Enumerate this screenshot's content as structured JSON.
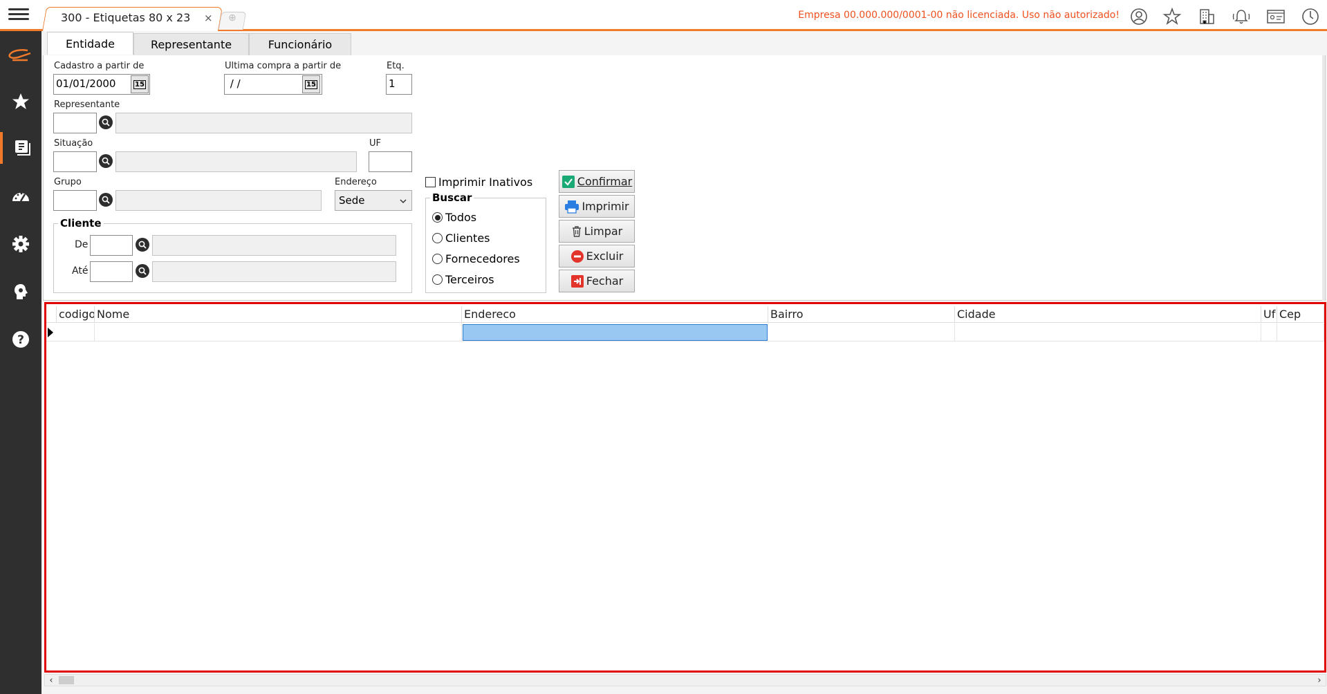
{
  "app": {
    "tab_title": "300 - Etiquetas 80 x 23",
    "tab_close": "×",
    "warning": "Empresa 00.000.000/0001-00 não licenciada. Uso não autorizado!"
  },
  "form_tabs": [
    "Entidade",
    "Representante",
    "Funcionário"
  ],
  "form": {
    "cadastro_label": "Cadastro a partir de",
    "cadastro_value": "01/01/2000",
    "ultima_compra_label": "Ultima compra a partir de",
    "ultima_compra_value": " / /",
    "etq_label": "Etq.",
    "etq_value": "1",
    "representante_label": "Representante",
    "situacao_label": "Situação",
    "uf_label": "UF",
    "grupo_label": "Grupo",
    "endereco_label": "Endereço",
    "endereco_value": "Sede",
    "cliente_group": "Cliente",
    "de_label": "De",
    "ate_label": "Até",
    "imprimir_inativos": "Imprimir Inativos",
    "buscar_group": "Buscar",
    "buscar_options": [
      "Todos",
      "Clientes",
      "Fornecedores",
      "Terceiros"
    ],
    "buscar_selected": "Todos",
    "cal_icon_text": "15"
  },
  "buttons": {
    "confirmar": "Confirmar",
    "imprimir": "Imprimir",
    "limpar": "Limpar",
    "excluir": "Excluir",
    "fechar": "Fechar"
  },
  "grid": {
    "columns": [
      "codigo",
      "Nome",
      "Endereco",
      "Bairro",
      "Cidade",
      "Uf",
      "Cep"
    ]
  },
  "colors": {
    "accent": "#f07a2a",
    "warning": "#f0501e",
    "highlight_border": "#e00000",
    "selected_cell": "#99c9f3"
  }
}
